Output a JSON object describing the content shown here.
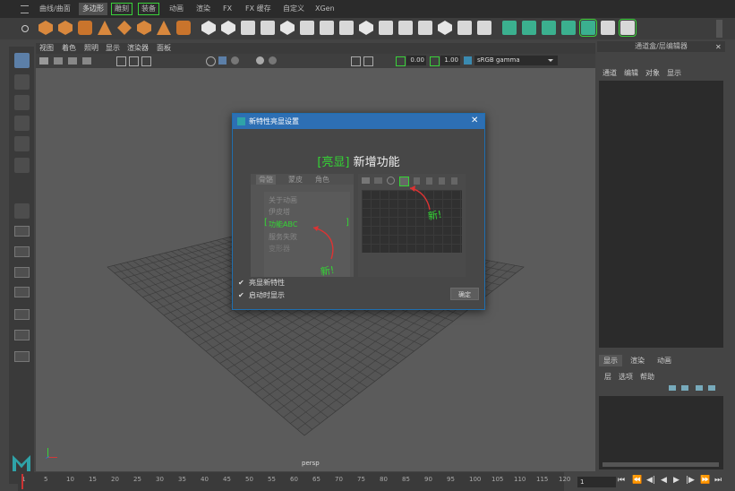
{
  "top_tabs": [
    {
      "label": "曲线/曲面",
      "active": false,
      "highlighted": false
    },
    {
      "label": "多边形",
      "active": true,
      "highlighted": false
    },
    {
      "label": "雕刻",
      "active": false,
      "highlighted": true
    },
    {
      "label": "装备",
      "active": false,
      "highlighted": true
    },
    {
      "label": "动画",
      "active": false,
      "highlighted": false
    },
    {
      "label": "渲染",
      "active": false,
      "highlighted": false
    },
    {
      "label": "FX",
      "active": false,
      "highlighted": false
    },
    {
      "label": "FX 缓存",
      "active": false,
      "highlighted": false
    },
    {
      "label": "自定义",
      "active": false,
      "highlighted": false
    },
    {
      "label": "XGen",
      "active": false,
      "highlighted": false
    }
  ],
  "viewport": {
    "menu": [
      "视图",
      "着色",
      "照明",
      "显示",
      "渲染器",
      "面板"
    ],
    "toolbar": {
      "value1": "0.00",
      "value2": "1.00",
      "color_space": "sRGB gamma"
    },
    "camera_label": "persp"
  },
  "right_panel": {
    "title": "通道盒/层编辑器",
    "menu": [
      "通道",
      "编辑",
      "对象",
      "显示"
    ],
    "tabs": [
      "显示",
      "渲染",
      "动画"
    ],
    "layer_menu": [
      "层",
      "选项",
      "帮助"
    ]
  },
  "timeline": {
    "ticks": [
      "1",
      "5",
      "10",
      "15",
      "20",
      "25",
      "30",
      "35",
      "40",
      "45",
      "50",
      "55",
      "60",
      "65",
      "70",
      "75",
      "80",
      "85",
      "90",
      "95",
      "100",
      "105",
      "110",
      "115",
      "120"
    ],
    "current_frame": "1"
  },
  "dialog": {
    "title": "新特性亮显设置",
    "heading_bracket": "[亮显]",
    "heading_text": "新增功能",
    "preview_tabs": [
      "骨骼",
      "蒙皮",
      "角色"
    ],
    "preview_items": [
      "关于动画",
      "伊皮塔",
      "功能ABC",
      "服务失败",
      "变形器"
    ],
    "new_label_1": "新!",
    "new_label_2": "新!",
    "checkbox1": "亮显新特性",
    "checkbox2": "启动时显示",
    "ok_button": "确定"
  },
  "colors": {
    "accent_green": "#34d634",
    "title_blue": "#2d6fb4",
    "orange_icon": "#d9883d",
    "teal_icon": "#3bb08f"
  }
}
